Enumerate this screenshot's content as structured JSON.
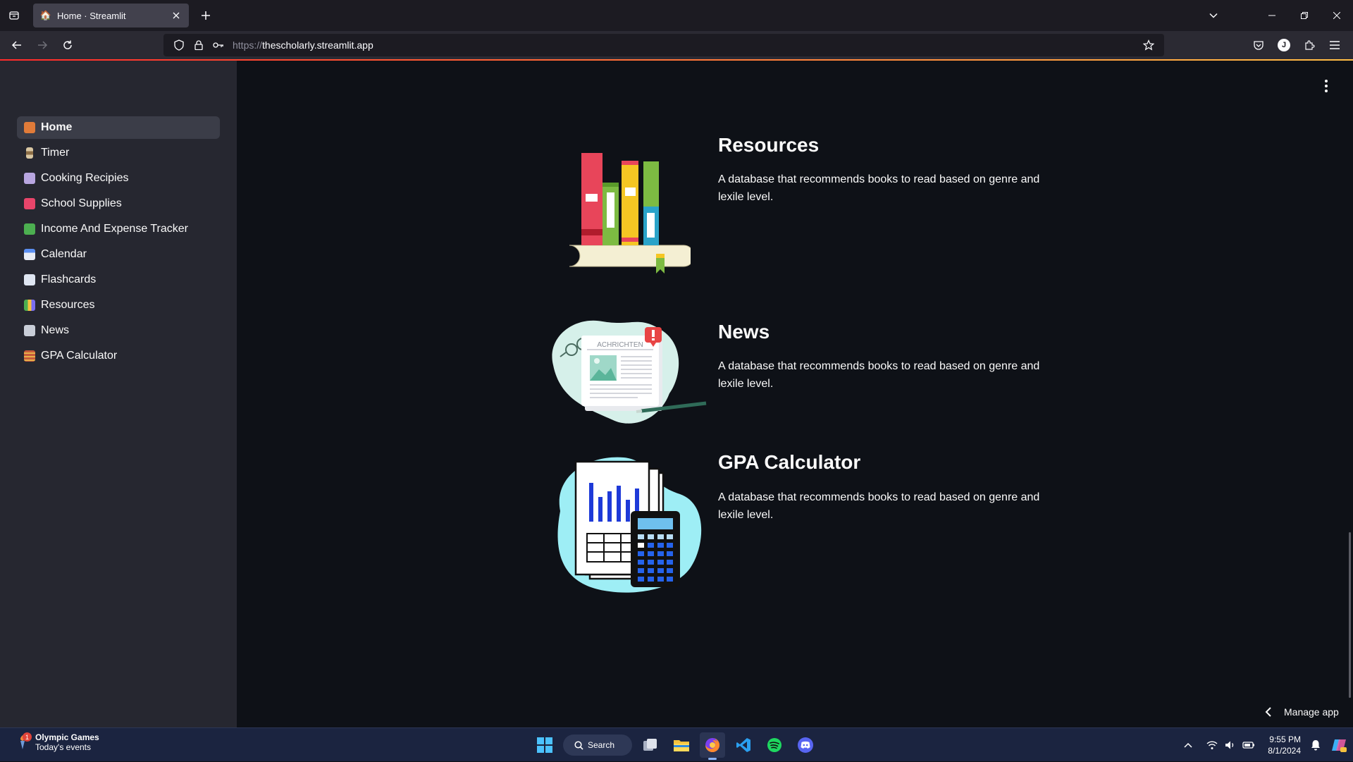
{
  "browser": {
    "tab_title": "Home · Streamlit",
    "url_protocol": "https://",
    "url_host": "thescholarly.streamlit.app",
    "profile_initial": "J"
  },
  "sidebar": {
    "items": [
      {
        "label": "Home",
        "icon": "house-icon",
        "active": true
      },
      {
        "label": "Timer",
        "icon": "hourglass-icon",
        "active": false
      },
      {
        "label": "Cooking Recipies",
        "icon": "cooking-icon",
        "active": false
      },
      {
        "label": "School Supplies",
        "icon": "backpack-icon",
        "active": false
      },
      {
        "label": "Income And Expense Tracker",
        "icon": "money-icon",
        "active": false
      },
      {
        "label": "Calendar",
        "icon": "calendar-icon",
        "active": false
      },
      {
        "label": "Flashcards",
        "icon": "card-icon",
        "active": false
      },
      {
        "label": "Resources",
        "icon": "books-icon",
        "active": false
      },
      {
        "label": "News",
        "icon": "newspaper-icon",
        "active": false
      },
      {
        "label": "GPA Calculator",
        "icon": "abacus-icon",
        "active": false
      }
    ]
  },
  "main": {
    "cards": [
      {
        "title": "Resources",
        "description": "A database that recommends books to read based on genre and lexile level."
      },
      {
        "title": "News",
        "description": "A database that recommends books to read based on genre and lexile level.",
        "illustration_text": "ACHRICHTEN"
      },
      {
        "title": "GPA Calculator",
        "description": "A database that recommends books to read based on genre and lexile level."
      }
    ],
    "manage_app_label": "Manage app"
  },
  "taskbar": {
    "weather_title": "Olympic Games",
    "weather_subtitle": "Today's events",
    "weather_badge": "1",
    "search_label": "Search",
    "time": "9:55 PM",
    "date": "8/1/2024"
  },
  "colors": {
    "app_bg": "#0e1117",
    "sidebar_bg": "#262730",
    "accent_start": "#ff2b2b",
    "accent_end": "#ffbd45"
  }
}
